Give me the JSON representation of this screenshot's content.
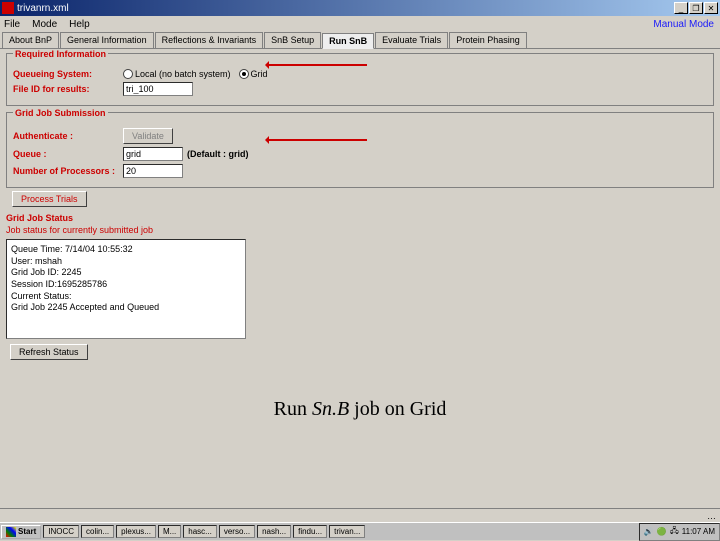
{
  "window": {
    "title": "trivanrn.xml",
    "mode_label": "Manual Mode"
  },
  "winbtns": {
    "min": "_",
    "max": "❐",
    "close": "✕"
  },
  "menus": [
    "File",
    "Mode",
    "Help"
  ],
  "tabs": [
    {
      "label": "About BnP"
    },
    {
      "label": "General Information"
    },
    {
      "label": "Reflections & Invariants"
    },
    {
      "label": "SnB Setup"
    },
    {
      "label": "Run SnB",
      "active": true
    },
    {
      "label": "Evaluate Trials"
    },
    {
      "label": "Protein Phasing"
    }
  ],
  "required": {
    "legend": "Required Information",
    "queueing_label": "Queueing System:",
    "opt_local": "Local (no batch system)",
    "opt_grid": "Grid",
    "file_label": "File ID for results:",
    "file_value": "tri_100"
  },
  "submission": {
    "legend": "Grid Job Submission",
    "auth_label": "Authenticate :",
    "validate_btn": "Validate",
    "queue_label": "Queue :",
    "queue_value": "grid",
    "queue_default": "(Default : grid)",
    "procs_label": "Number of Processors :",
    "procs_value": "20",
    "process_btn": "Process Trials"
  },
  "status": {
    "title": "Grid Job Status",
    "subtitle": "Job status for currently submitted job",
    "lines": {
      "l1": "Queue Time: 7/14/04 10:55:32",
      "l2": "User: mshah",
      "l3": "Grid Job ID: 2245",
      "l4": "Session ID:1695285786",
      "l5": "",
      "l6": "Current Status:",
      "l7": "",
      "l8": "Grid Job 2245 Accepted and Queued"
    },
    "refresh_btn": "Refresh Status"
  },
  "caption": {
    "before": "Run ",
    "ital": "Sn.B",
    "after": " job on Grid"
  },
  "scroll_ellipsis": "…",
  "taskbar": {
    "start": "Start",
    "items": [
      "INOCC",
      "colin...",
      "plexus...",
      "M...",
      "hasc...",
      "verso...",
      "nash...",
      "findu...",
      "trivan..."
    ],
    "clock": "11:07 AM",
    "tray": [
      "🔊",
      "🟢",
      "🖧"
    ]
  }
}
